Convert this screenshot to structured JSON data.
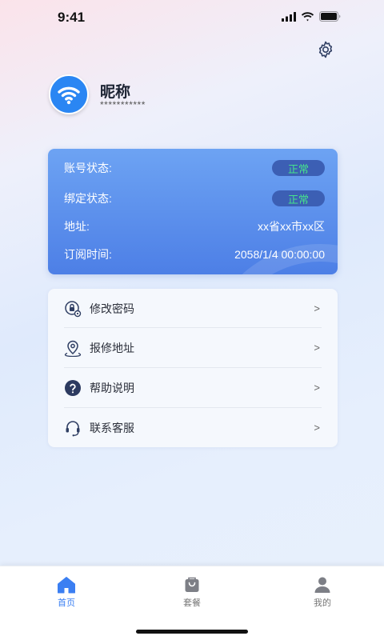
{
  "status_bar": {
    "time": "9:41"
  },
  "profile": {
    "nickname": "昵称",
    "account": "***********"
  },
  "account_card": {
    "rows": [
      {
        "label": "账号状态:",
        "value": "正常"
      },
      {
        "label": "绑定状态:",
        "value": "正常"
      },
      {
        "label": "地址:",
        "value": "xx省xx市xx区"
      },
      {
        "label": "订阅时间:",
        "value": "2058/1/4 00:00:00"
      }
    ]
  },
  "menu": {
    "items": [
      {
        "label": "修改密码",
        "arrow": ">",
        "icon": "lock-gear-icon"
      },
      {
        "label": "报修地址",
        "arrow": ">",
        "icon": "location-pin-icon"
      },
      {
        "label": "帮助说明",
        "arrow": ">",
        "icon": "help-icon"
      },
      {
        "label": "联系客服",
        "arrow": ">",
        "icon": "headset-icon"
      }
    ]
  },
  "tab_bar": {
    "tabs": [
      {
        "label": "首页",
        "icon": "home-icon",
        "active": true
      },
      {
        "label": "套餐",
        "icon": "bag-icon",
        "active": false
      },
      {
        "label": "我的",
        "icon": "user-icon",
        "active": false
      }
    ]
  },
  "colors": {
    "accent": "#3b7ff2",
    "card_top": "#6da3f3",
    "card_bottom": "#4d7fe6",
    "status_ok": "#46e28c"
  }
}
